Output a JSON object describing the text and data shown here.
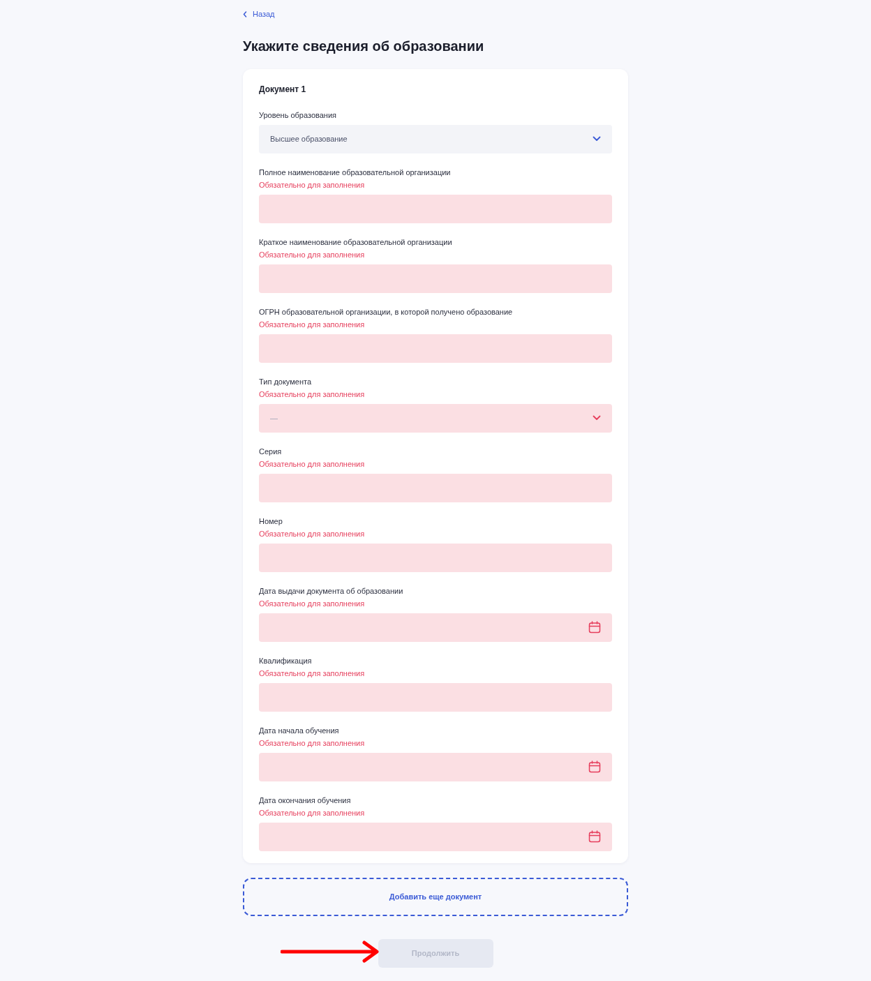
{
  "back_link": "Назад",
  "title": "Укажите сведения об образовании",
  "documents": [
    {
      "heading": "Документ 1",
      "fields": [
        {
          "kind": "select",
          "label": "Уровень образования",
          "value": "Высшее образование"
        },
        {
          "kind": "text",
          "label": "Полное наименование образовательной организации",
          "error": "Обязательно для заполнения"
        },
        {
          "kind": "text",
          "label": "Краткое наименование образовательной организации",
          "error": "Обязательно для заполнения"
        },
        {
          "kind": "text",
          "label": "ОГРН образовательной организации, в которой получено образование",
          "error": "Обязательно для заполнения"
        },
        {
          "kind": "select",
          "label": "Тип документа",
          "value": "—",
          "error": "Обязательно для заполнения"
        },
        {
          "kind": "text",
          "label": "Серия",
          "error": "Обязательно для заполнения"
        },
        {
          "kind": "text",
          "label": "Номер",
          "error": "Обязательно для заполнения"
        },
        {
          "kind": "date",
          "label": "Дата выдачи документа об образовании",
          "error": "Обязательно для заполнения"
        },
        {
          "kind": "text",
          "label": "Квалификация",
          "error": "Обязательно для заполнения"
        },
        {
          "kind": "date",
          "label": "Дата начала обучения",
          "error": "Обязательно для заполнения"
        },
        {
          "kind": "date",
          "label": "Дата окончания обучения",
          "error": "Обязательно для заполнения"
        }
      ]
    }
  ],
  "add_button": "Добавить еще документ",
  "continue_button": {
    "label": "Продолжить",
    "disabled": true
  }
}
